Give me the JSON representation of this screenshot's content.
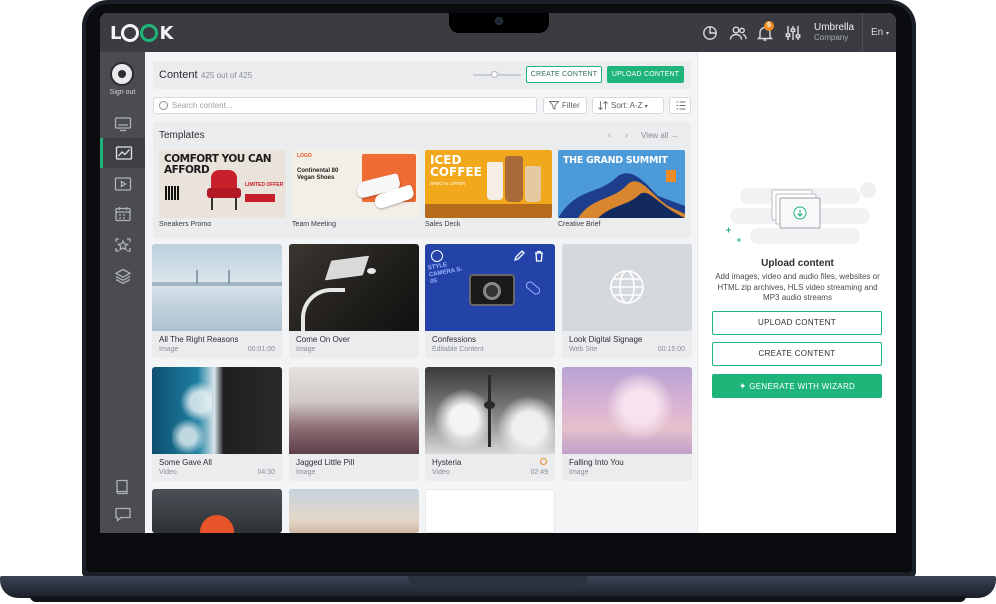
{
  "brand": {
    "logo_text_l": "L",
    "logo_text_k": "K"
  },
  "colors": {
    "accent": "#1fb57a",
    "topbar": "#3a3c41",
    "sidebar": "#4a4c51",
    "notification": "#f08a24"
  },
  "topbar": {
    "icons": [
      "analytics-icon",
      "users-icon",
      "bell-icon",
      "sliders-icon"
    ],
    "notification_count": "5",
    "account_name": "Umbrella",
    "account_org": "Company",
    "language": "En"
  },
  "sidebar": {
    "sign_out": "Sign out",
    "items": [
      "screens",
      "analytics",
      "playlists",
      "schedule",
      "widgets",
      "layers"
    ],
    "bottom_items": [
      "book",
      "chat"
    ]
  },
  "content": {
    "title": "Content",
    "count": "425 out of 425",
    "create_label": "CREATE CONTENT",
    "upload_label": "UPLOAD CONTENT",
    "search_placeholder": "Search content...",
    "filter_label": "Filter",
    "sort_label": "Sort: A-Z"
  },
  "templates": {
    "title": "Templates",
    "view_all": "View all",
    "prev": "‹",
    "next": "›",
    "items": [
      {
        "label": "Sneakers Promo",
        "headline": "COMFORT YOU CAN AFFORD",
        "tag": "LIMITED OFFER"
      },
      {
        "label": "Team Meeting",
        "headline": "Continental 80 Vegan Shoes",
        "tag": "LOGO"
      },
      {
        "label": "Sales Deck",
        "headline": "ICED COFFEE",
        "tag": "SPECIAL OFFER"
      },
      {
        "label": "Creative Brief",
        "headline": "THE GRAND SUMMIT"
      }
    ]
  },
  "items": [
    {
      "title": "All The Right Reasons",
      "type": "Image",
      "duration": "00:01:00"
    },
    {
      "title": "Come On Over",
      "type": "Image",
      "duration": ""
    },
    {
      "title": "Confessions",
      "type": "Editable Content",
      "duration": "",
      "overlay": "STYLE CAMERA S-05"
    },
    {
      "title": "Look Digital Signage",
      "type": "Web Site",
      "duration": "00:15:00"
    },
    {
      "title": "Some Gave All",
      "type": "Video",
      "duration": "04:30"
    },
    {
      "title": "Jagged Little Pill",
      "type": "Image",
      "duration": ""
    },
    {
      "title": "Hysteria",
      "type": "Video",
      "duration": "02:49"
    },
    {
      "title": "Falling Into You",
      "type": "Image",
      "duration": ""
    }
  ],
  "upload_panel": {
    "title": "Upload content",
    "description": "Add images, video and audio files, websites or HTML zip archives, HLS video streaming and MP3 audio streams",
    "upload_label": "UPLOAD CONTENT",
    "create_label": "CREATE CONTENT",
    "wizard_label": "GENERATE WITH WIZARD"
  }
}
